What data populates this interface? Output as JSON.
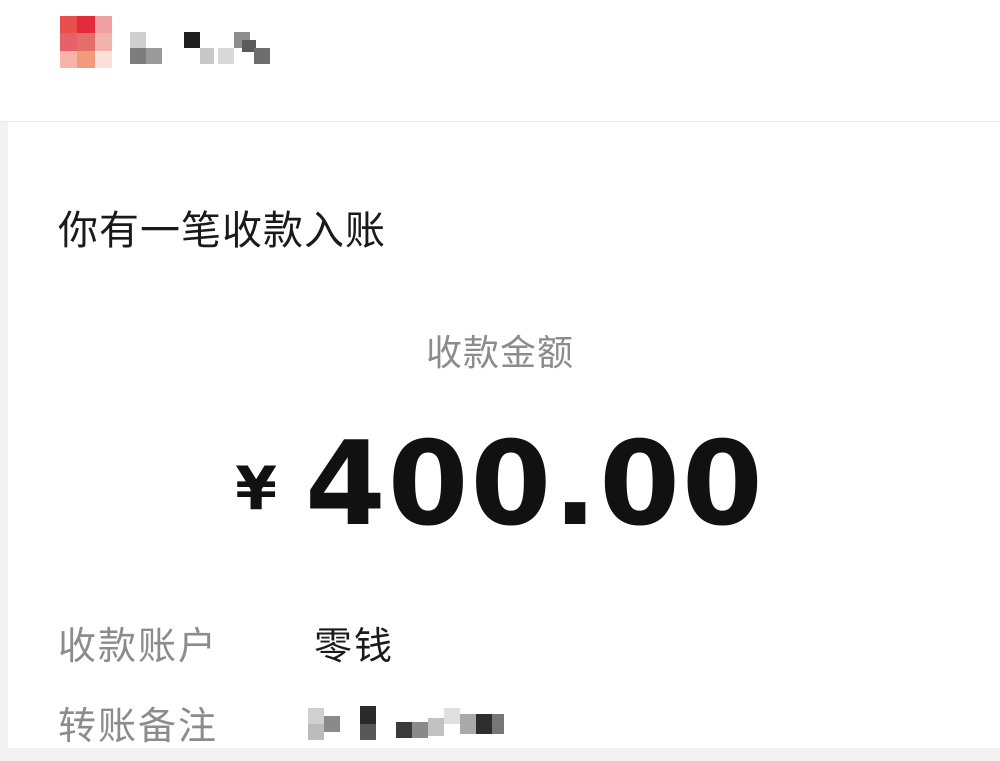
{
  "notice": {
    "title": "你有一笔收款入账",
    "amount_label": "收款金额",
    "currency_symbol": "¥",
    "amount": "400.00"
  },
  "details": [
    {
      "label": "收款账户",
      "value": "零钱"
    },
    {
      "label": "转账备注",
      "value": ""
    }
  ],
  "colors": {
    "text_primary": "#1a1a1a",
    "text_secondary": "#8c8c8c",
    "background": "#ffffff"
  }
}
